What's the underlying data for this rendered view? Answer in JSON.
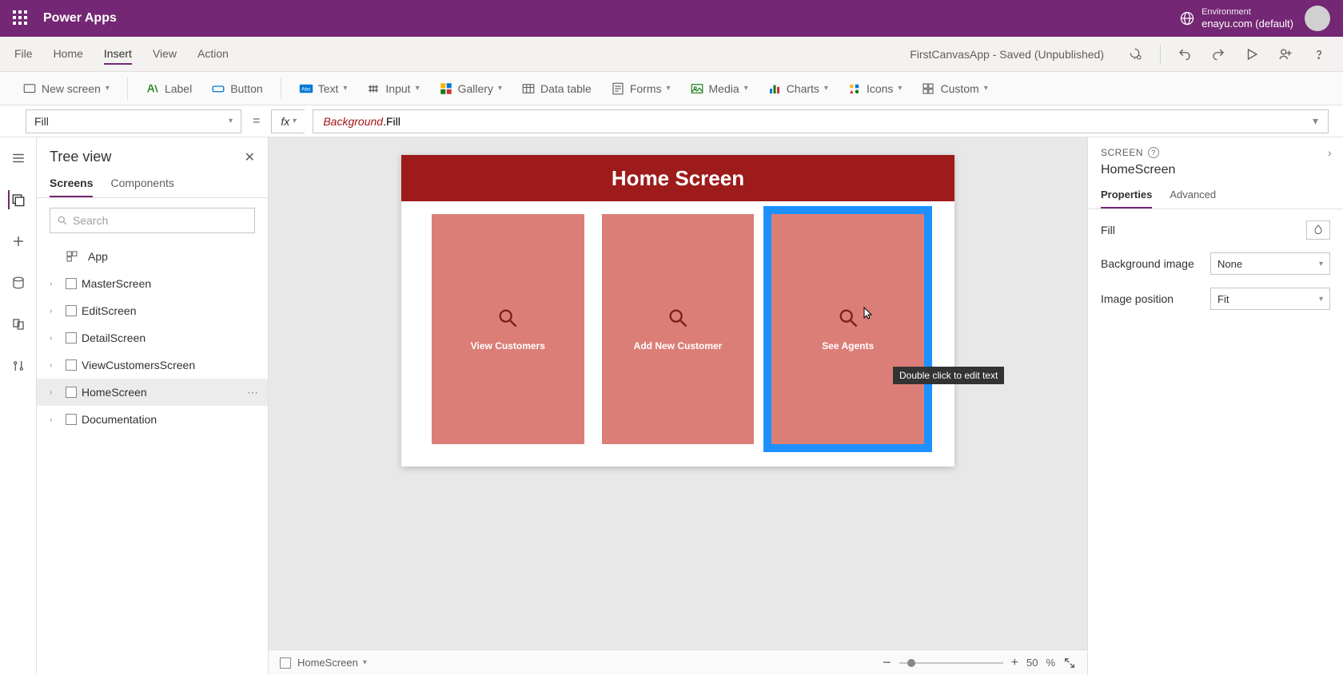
{
  "topbar": {
    "app_title": "Power Apps",
    "env_label": "Environment",
    "env_value": "enayu.com (default)"
  },
  "menus": {
    "file": "File",
    "home": "Home",
    "insert": "Insert",
    "view": "View",
    "action": "Action",
    "active": "insert"
  },
  "doc_status": "FirstCanvasApp - Saved (Unpublished)",
  "ribbon": {
    "new_screen": "New screen",
    "label": "Label",
    "button": "Button",
    "text": "Text",
    "input": "Input",
    "gallery": "Gallery",
    "data_table": "Data table",
    "forms": "Forms",
    "media": "Media",
    "charts": "Charts",
    "icons": "Icons",
    "custom": "Custom"
  },
  "formula": {
    "property": "Fill",
    "object": "Background",
    "prop": "Fill"
  },
  "tree": {
    "title": "Tree view",
    "tabs": {
      "screens": "Screens",
      "components": "Components"
    },
    "search_placeholder": "Search",
    "app_label": "App",
    "items": [
      "MasterScreen",
      "EditScreen",
      "DetailScreen",
      "ViewCustomersScreen",
      "HomeScreen",
      "Documentation"
    ],
    "selected": "HomeScreen"
  },
  "canvas": {
    "screen_title": "Home Screen",
    "cards": [
      {
        "label": "View Customers"
      },
      {
        "label": "Add New Customer"
      },
      {
        "label": "See Agents"
      }
    ],
    "selected_card_index": 2,
    "tooltip": "Double click to edit text"
  },
  "rpanel": {
    "head": "SCREEN",
    "name": "HomeScreen",
    "tabs": {
      "properties": "Properties",
      "advanced": "Advanced"
    },
    "props": {
      "fill_label": "Fill",
      "bg_image_label": "Background image",
      "bg_image_value": "None",
      "img_pos_label": "Image position",
      "img_pos_value": "Fit"
    }
  },
  "status": {
    "screen": "HomeScreen",
    "zoom": "50",
    "pct": "%"
  }
}
